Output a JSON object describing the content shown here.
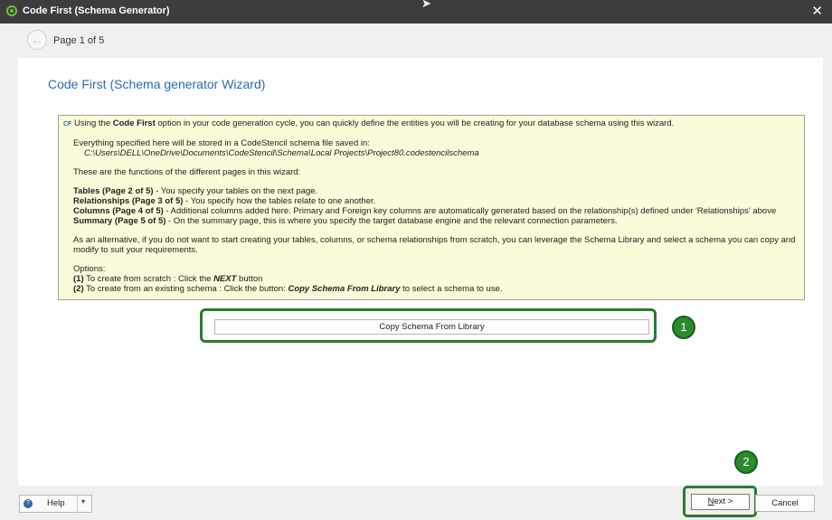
{
  "window": {
    "title": "Code First (Schema Generator)",
    "close_glyph": "✕"
  },
  "nav": {
    "page_indicator": "Page 1 of 5"
  },
  "wizard": {
    "title": "Code First (Schema generator Wizard)"
  },
  "info": {
    "icon_text": "CF",
    "intro_before": "Using the ",
    "intro_bold": "Code First",
    "intro_after": " option in your code generation cycle, you can quickly define the entities you will be creating for your database schema using this wizard.",
    "storage_line": "Everything specified here will be stored in a CodeStencil schema file saved in:",
    "storage_path": "C:\\Users\\DELL\\OneDrive\\Documents\\CodeStencil\\Schema\\Local Projects\\Project80.codestencilschema",
    "functions_heading": "These are the functions of the different pages in this wizard:",
    "pages": [
      {
        "name": "Tables (Page 2 of 5)",
        "desc": " - You specify your tables on the next page."
      },
      {
        "name": "Relationships (Page 3 of 5)",
        "desc": " - You specify how the tables relate to one another."
      },
      {
        "name": "Columns (Page 4 of 5)",
        "desc": " - Additional columns added here. Primary and Foreign key columns are automatically generated based on the relationship(s) defined under 'Relationships' above"
      },
      {
        "name": "Summary (Page 5 of 5)",
        "desc": " - On the summary page, this is where you specify the target database engine and the relevant connection parameters."
      }
    ],
    "alternative": "As an alternative, if you do not want to start creating your tables, columns, or schema relationships from scratch, you can leverage the Schema Library and select a schema you can copy and modify to suit your requirements.",
    "options_heading": "Options:",
    "option1_num": "(1)",
    "option1_text": " To create from scratch : Click the ",
    "option1_btn": "NEXT",
    "option1_after": " button",
    "option2_num": "(2)",
    "option2_text": " To create from an existing schema : Click the button: ",
    "option2_btn": "Copy Schema From Library",
    "option2_after": " to select a schema to use."
  },
  "copy_button_label": "Copy Schema From Library",
  "callouts": [
    "1",
    "2"
  ],
  "footer": {
    "help_label": "Help",
    "help_icon_glyph": "?",
    "dropdown_glyph": "▾",
    "next_mnemonic": "N",
    "next_rest": "ext >",
    "cancel_label": "Cancel"
  },
  "colors": {
    "accent_green": "#2a7a32",
    "title_blue": "#2a6bb0",
    "info_bg": "#fbfbd9"
  }
}
